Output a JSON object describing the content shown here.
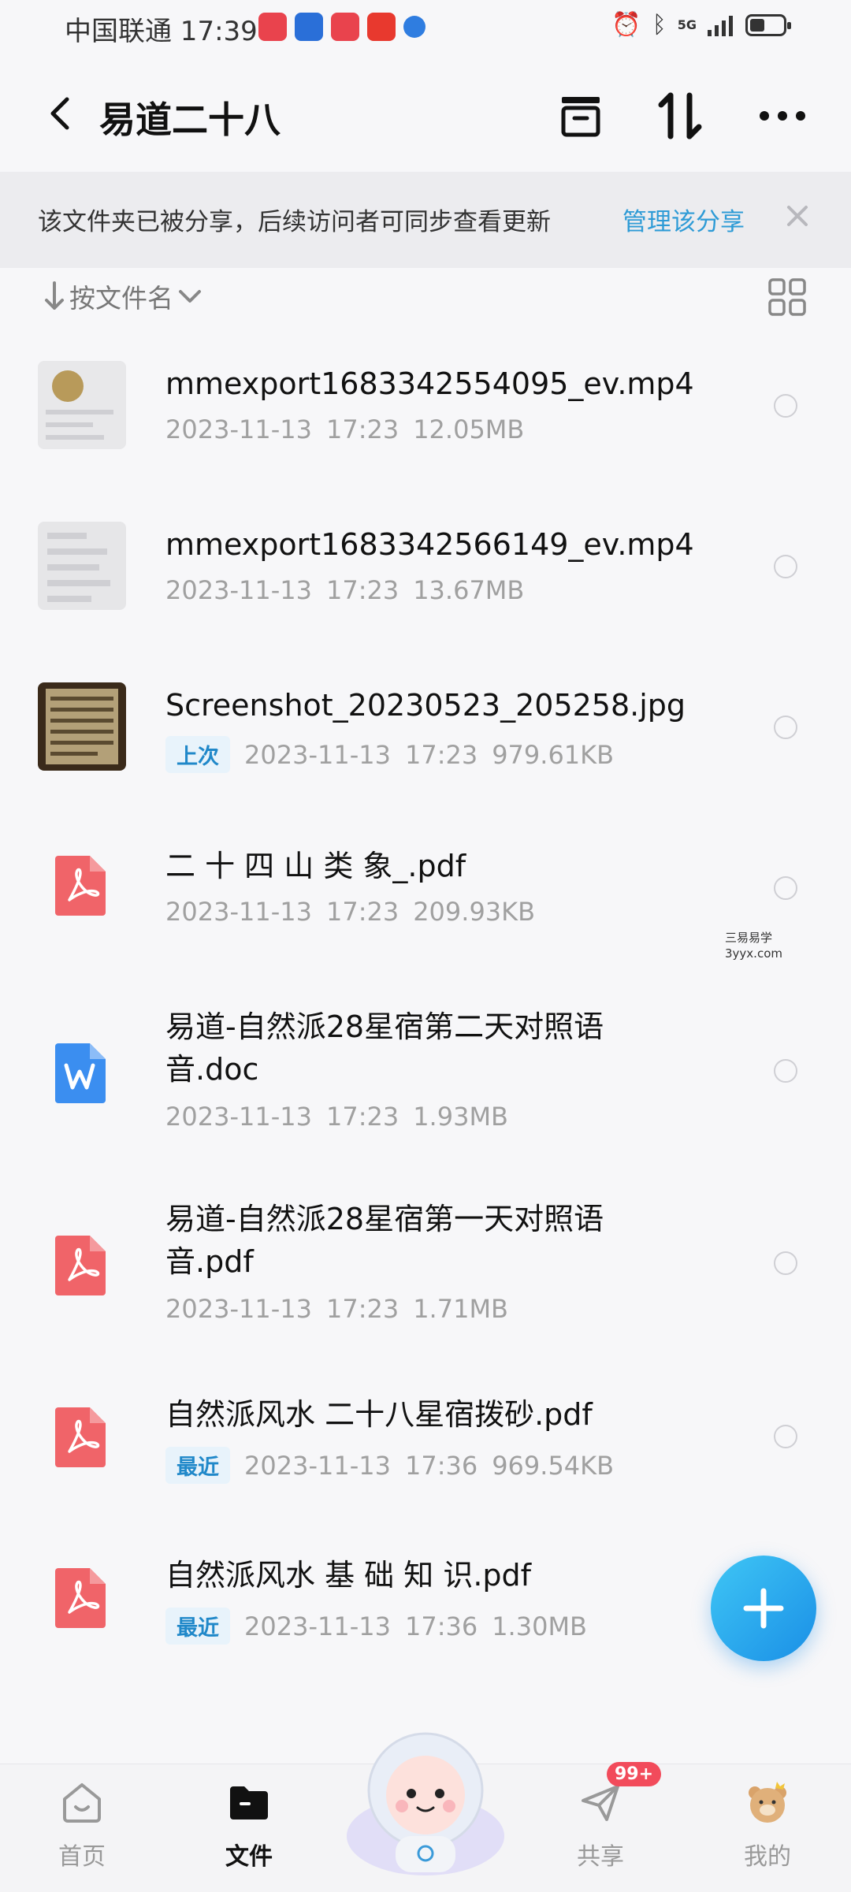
{
  "status_bar": {
    "carrier_time": "中国联通 17:39",
    "network": "5G",
    "battery_level": 0.45
  },
  "header": {
    "title": "易道二十八"
  },
  "banner": {
    "message": "该文件夹已被分享，后续访问者可同步查看更新",
    "link": "管理该分享"
  },
  "sort": {
    "label": "按文件名"
  },
  "files": [
    {
      "name": "mmexport1683342554095_ev.mp4",
      "tag": "",
      "date": "2023-11-13",
      "time": "17:23",
      "size": "12.05MB",
      "kind": "video"
    },
    {
      "name": "mmexport1683342566149_ev.mp4",
      "tag": "",
      "date": "2023-11-13",
      "time": "17:23",
      "size": "13.67MB",
      "kind": "video"
    },
    {
      "name": "Screenshot_20230523_205258.jpg",
      "tag": "上次",
      "date": "2023-11-13",
      "time": "17:23",
      "size": "979.61KB",
      "kind": "image"
    },
    {
      "name": "二 十 四 山 类 象_.pdf",
      "tag": "",
      "date": "2023-11-13",
      "time": "17:23",
      "size": "209.93KB",
      "kind": "pdf"
    },
    {
      "name": "易道-自然派28星宿第二天对照语音.doc",
      "tag": "",
      "date": "2023-11-13",
      "time": "17:23",
      "size": "1.93MB",
      "kind": "doc"
    },
    {
      "name": "易道-自然派28星宿第一天对照语音.pdf",
      "tag": "",
      "date": "2023-11-13",
      "time": "17:23",
      "size": "1.71MB",
      "kind": "pdf"
    },
    {
      "name": "自然派风水 二十八星宿拨砂.pdf",
      "tag": "最近",
      "date": "2023-11-13",
      "time": "17:36",
      "size": "969.54KB",
      "kind": "pdf"
    },
    {
      "name": "自然派风水 基 础 知 识.pdf",
      "tag": "最近",
      "date": "2023-11-13",
      "time": "17:36",
      "size": "1.30MB",
      "kind": "pdf"
    }
  ],
  "watermark": {
    "line1": "三易易学",
    "line2": "3yyx.com"
  },
  "bottom_nav": {
    "home": "首页",
    "files": "文件",
    "share": "共享",
    "share_badge": "99+",
    "me": "我的"
  },
  "colors": {
    "accent": "#2e9bd6",
    "pdf": "#f06469",
    "doc": "#3b8ef0",
    "fab": "#1a8fe6",
    "badge": "#f24b5b"
  }
}
